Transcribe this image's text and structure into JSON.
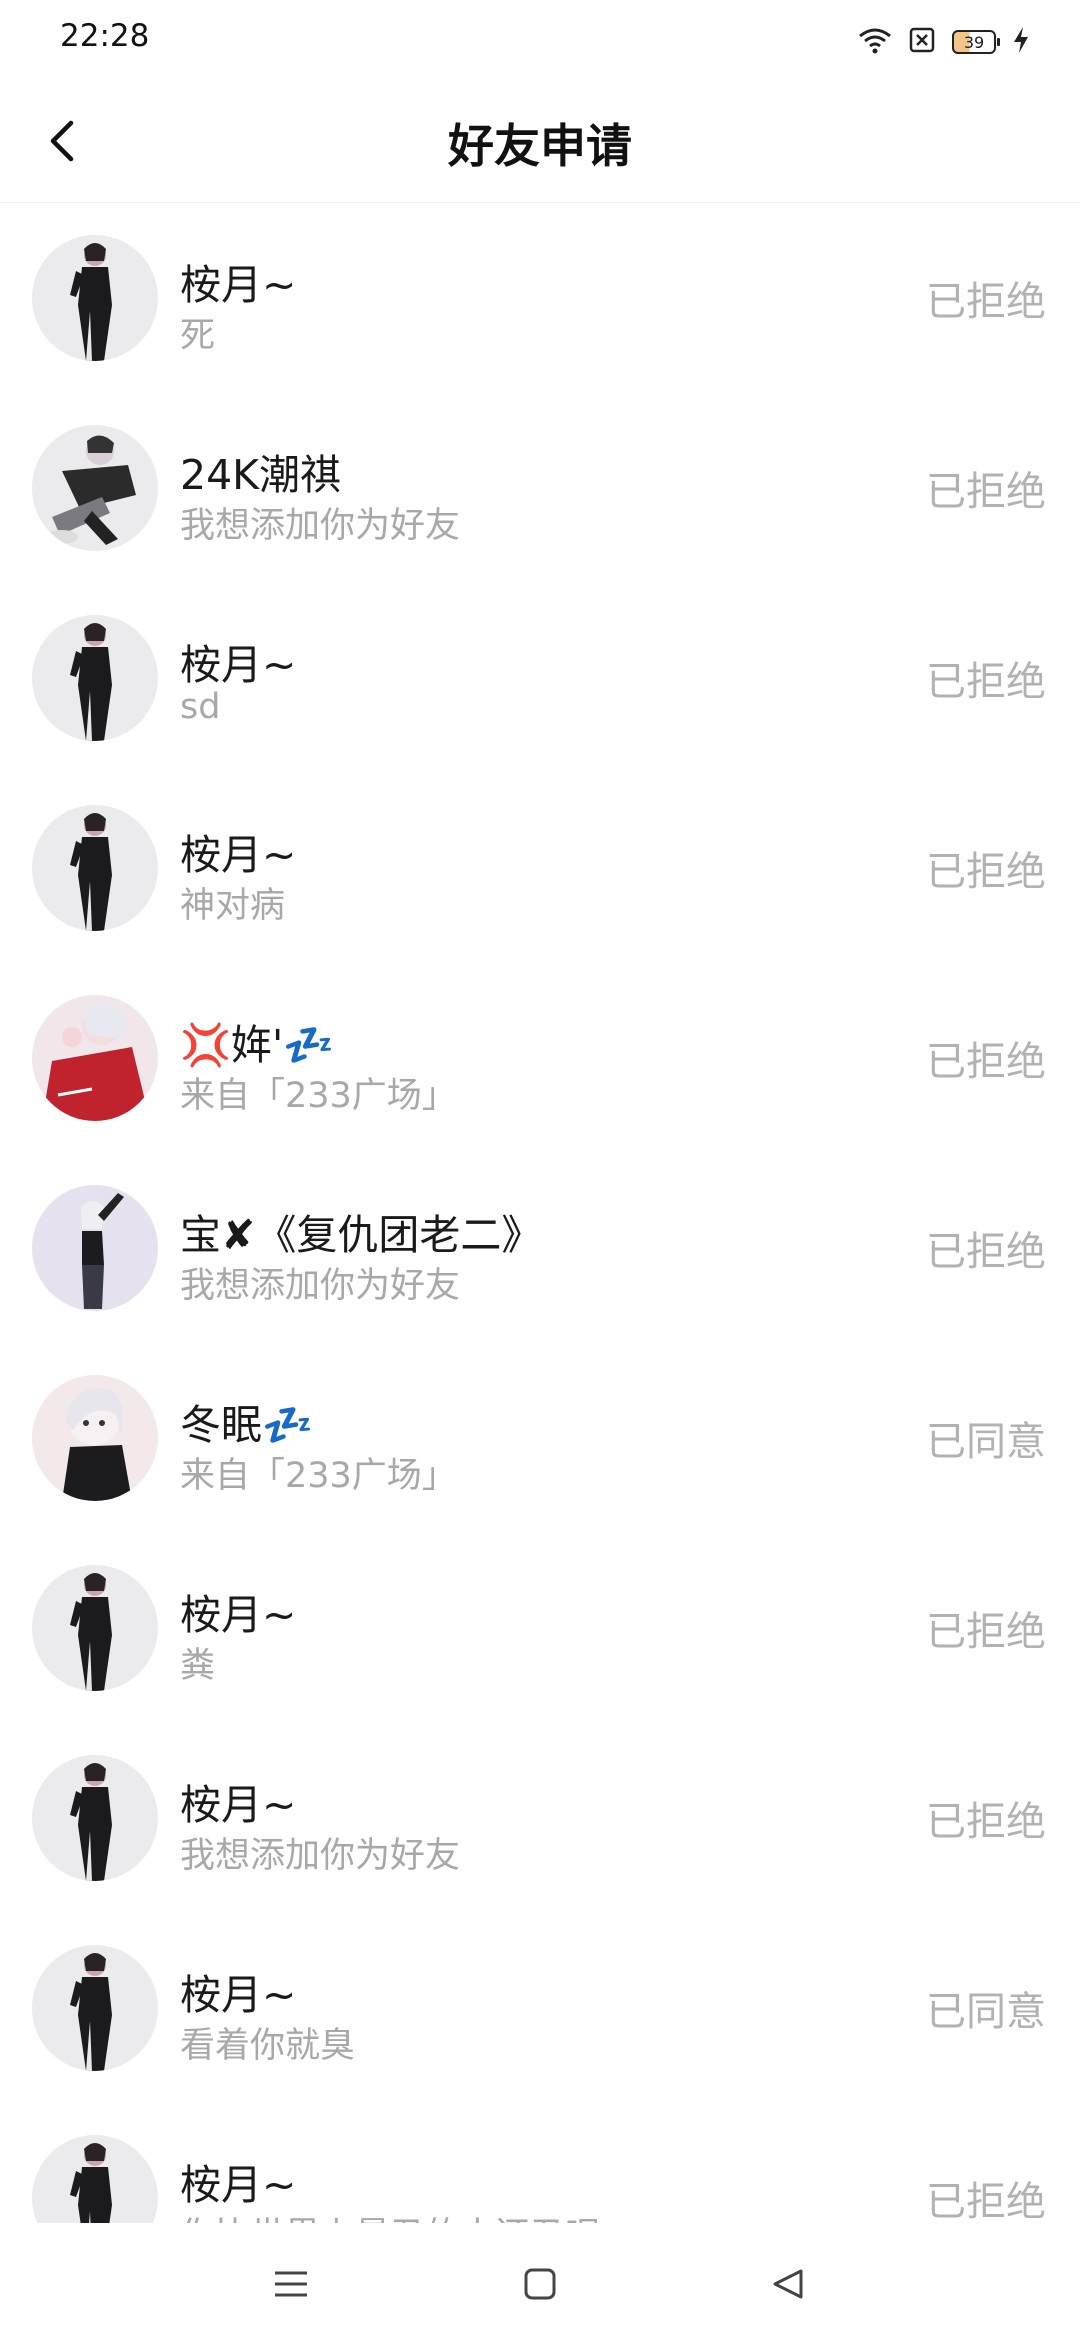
{
  "status_bar": {
    "time": "22:28",
    "battery": "39"
  },
  "header": {
    "title": "好友申请"
  },
  "requests": [
    {
      "name": "桉月~",
      "message": "死",
      "status": "已拒绝",
      "avatar": "gothic-girl",
      "bg": "#ebebed"
    },
    {
      "name": "24K潮祺",
      "message": "我想添加你为好友",
      "status": "已拒绝",
      "avatar": "sitting-boy",
      "bg": "#ebebed"
    },
    {
      "name": "桉月~",
      "message": "sd",
      "status": "已拒绝",
      "avatar": "gothic-girl",
      "bg": "#ebebed"
    },
    {
      "name": "桉月~",
      "message": "神对病",
      "status": "已拒绝",
      "avatar": "gothic-girl",
      "bg": "#ebebed"
    },
    {
      "name": "💢姩'💤",
      "message": "来自「233广场」",
      "status": "已拒绝",
      "avatar": "red-sweater-girl",
      "bg": "#f1e6ea"
    },
    {
      "name": "宝✘《复仇团老二》",
      "message": "我想添加你为好友",
      "status": "已拒绝",
      "avatar": "posing-girl",
      "bg": "#e5e1ef"
    },
    {
      "name": "冬眠💤",
      "message": "来自「233广场」",
      "status": "已同意",
      "avatar": "white-hair-girl",
      "bg": "#f3e8ea"
    },
    {
      "name": "桉月~",
      "message": "粪",
      "status": "已拒绝",
      "avatar": "gothic-girl",
      "bg": "#ebebed"
    },
    {
      "name": "桉月~",
      "message": "我想添加你为好友",
      "status": "已拒绝",
      "avatar": "gothic-girl",
      "bg": "#ebebed"
    },
    {
      "name": "桉月~",
      "message": "看着你就臭",
      "status": "已同意",
      "avatar": "gothic-girl",
      "bg": "#ebebed"
    },
    {
      "name": "桉月~",
      "message": "你比世界上最丑的人还丑呢",
      "status": "已拒绝",
      "avatar": "gothic-girl",
      "bg": "#ebebed"
    }
  ],
  "icons": {
    "back": "chevron-left-icon",
    "wifi": "wifi-icon",
    "sim": "no-sim-icon",
    "charging": "lightning-icon",
    "nav_menu": "menu-icon",
    "nav_home": "square-icon",
    "nav_back": "triangle-back-icon"
  },
  "colors": {
    "text_primary": "#1a1a1a",
    "text_secondary": "#a8a8a8",
    "status_text": "#b2b2b2",
    "divider": "#ececec"
  }
}
